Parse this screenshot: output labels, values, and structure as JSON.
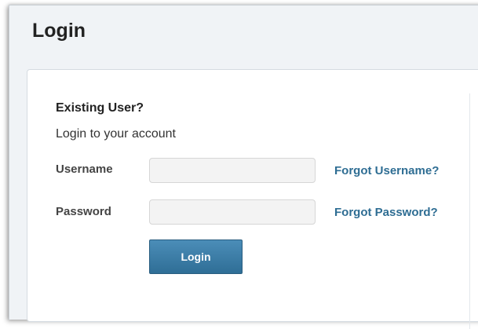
{
  "page": {
    "title": "Login"
  },
  "login_panel": {
    "heading": "Existing User?",
    "subtext": "Login to your account",
    "username": {
      "label": "Username",
      "value": "",
      "placeholder": "",
      "forgot_link": "Forgot Username?"
    },
    "password": {
      "label": "Password",
      "value": "",
      "placeholder": "",
      "forgot_link": "Forgot Password?"
    },
    "submit_label": "Login"
  },
  "colors": {
    "link": "#2e6d93",
    "button": "#3a7ca6",
    "background": "#f0f3f6"
  }
}
